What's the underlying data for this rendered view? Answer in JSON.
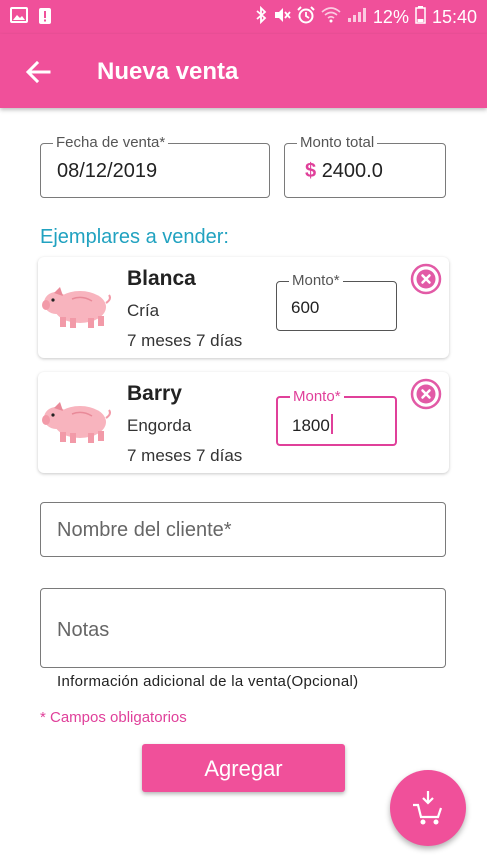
{
  "status_bar": {
    "left_icons": [
      "gallery-icon",
      "alert-icon"
    ],
    "right_icons": [
      "bluetooth-icon",
      "mute-icon",
      "alarm-icon",
      "wifi-icon",
      "signal-icon"
    ],
    "battery": "12%",
    "time": "15:40"
  },
  "app_bar": {
    "title": "Nueva venta",
    "back_icon": "arrow-left-icon"
  },
  "form": {
    "fecha": {
      "label": "Fecha de venta*",
      "value": "08/12/2019"
    },
    "monto_total": {
      "label": "Monto total",
      "currency": "$",
      "value": "2400.0"
    },
    "section_title": "Ejemplares a vender:",
    "animals": [
      {
        "name": "Blanca",
        "stage": "Cría",
        "age": "7 meses 7 días",
        "monto_label": "Monto*",
        "monto_value": "600"
      },
      {
        "name": "Barry",
        "stage": "Engorda",
        "age": "7 meses 7 días",
        "monto_label": "Monto*",
        "monto_value": "1800"
      }
    ],
    "cliente_placeholder": "Nombre del cliente*",
    "notas_placeholder": "Notas",
    "notas_helper": "Información adicional de la venta(Opcional)",
    "required_note": "* Campos obligatorios",
    "submit_label": "Agregar"
  },
  "colors": {
    "primary": "#f0509a",
    "accent": "#e0409a",
    "section": "#21a2c0"
  }
}
